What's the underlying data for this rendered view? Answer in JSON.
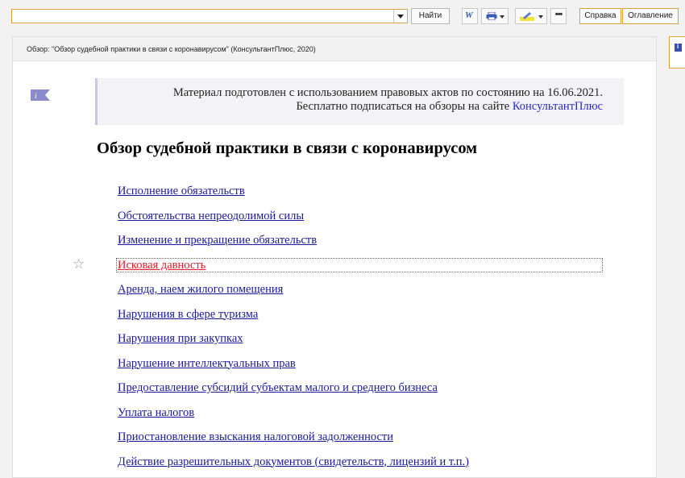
{
  "toolbar": {
    "search": {
      "value": "",
      "placeholder": ""
    },
    "find_label": "Найти",
    "help_label": "Справка",
    "toc_label": "Оглавление",
    "icons": {
      "dropdown": "chevron-down-icon",
      "word": "word-export-icon",
      "print": "printer-icon",
      "marker": "highlighter-icon",
      "more": "ellipsis-icon"
    }
  },
  "document": {
    "header": "Обзор: \"Обзор судебной практики в связи с коронавирусом\" (КонсультантПлюс, 2020)",
    "notice_line1": "Материал подготовлен с использованием правовых актов по состоянию на 16.06.2021.",
    "notice_line2_text": "Бесплатно подписаться на обзоры на сайте ",
    "notice_link": "КонсультантПлюс",
    "title": "Обзор судебной практики в связи с коронавирусом",
    "toc": [
      "Исполнение обязательств",
      "Обстоятельства непреодолимой силы",
      "Изменение и прекращение обязательств",
      "Исковая давность",
      "Аренда, наем жилого помещения",
      "Нарушения в сфере туризма",
      "Нарушения при закупках",
      "Нарушение интеллектуальных прав",
      "Предоставление субсидий субъектам малого и среднего бизнеса",
      "Уплата налогов",
      "Приостановление взыскания налоговой задолженности",
      "Действие разрешительных документов (свидетельств, лицензий и т.п.)"
    ],
    "active_index": 3
  },
  "colors": {
    "accent_border": "#e0a040",
    "link": "#1a1a9a",
    "active_link": "#e0202a",
    "notice_bg": "#f3f3f7"
  }
}
